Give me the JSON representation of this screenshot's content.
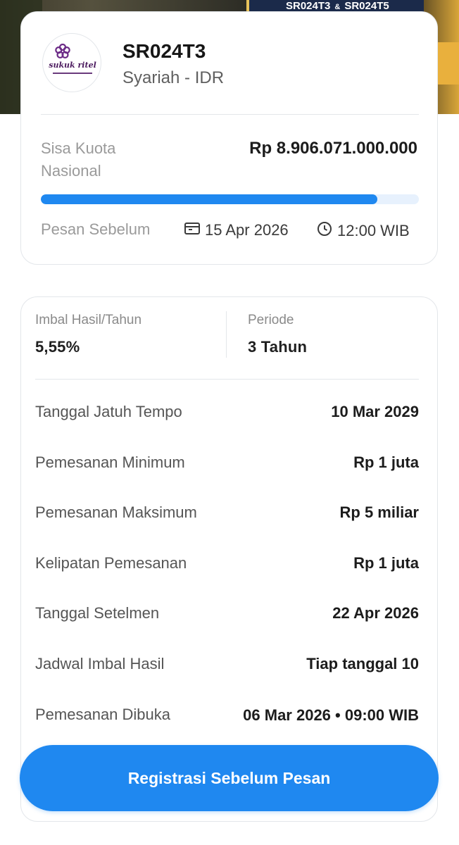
{
  "banner": {
    "series_left": "SR024T3",
    "series_amp": "&",
    "series_right": "SR024T5"
  },
  "product": {
    "logo_text": "sukuk ritel",
    "code": "SR024T3",
    "type": "Syariah - IDR"
  },
  "quota": {
    "label": "Sisa Kuota Nasional",
    "value": "Rp 8.906.071.000.000",
    "progress_fraction": 0.89
  },
  "deadline": {
    "label": "Pesan Sebelum",
    "date": "15 Apr 2026",
    "time": "12:00 WIB",
    "date_icon": "calendar-icon",
    "time_icon": "clock-icon"
  },
  "stats": {
    "yield_label": "Imbal Hasil/Tahun",
    "yield_value": "5,55%",
    "period_label": "Periode",
    "period_value": "3 Tahun"
  },
  "details": [
    {
      "label": "Tanggal Jatuh Tempo",
      "value": "10 Mar 2029"
    },
    {
      "label": "Pemesanan Minimum",
      "value": "Rp 1 juta"
    },
    {
      "label": "Pemesanan Maksimum",
      "value": "Rp 5 miliar"
    },
    {
      "label": "Kelipatan Pemesanan",
      "value": "Rp 1 juta"
    },
    {
      "label": "Tanggal Setelmen",
      "value": "22 Apr 2026"
    },
    {
      "label": "Jadwal Imbal Hasil",
      "value": "Tiap tanggal 10"
    },
    {
      "label": "Pemesanan Dibuka",
      "value": "06 Mar 2026 • 09:00 WIB"
    }
  ],
  "cta": {
    "label": "Registrasi Sebelum Pesan",
    "color": "#1f88f0"
  }
}
